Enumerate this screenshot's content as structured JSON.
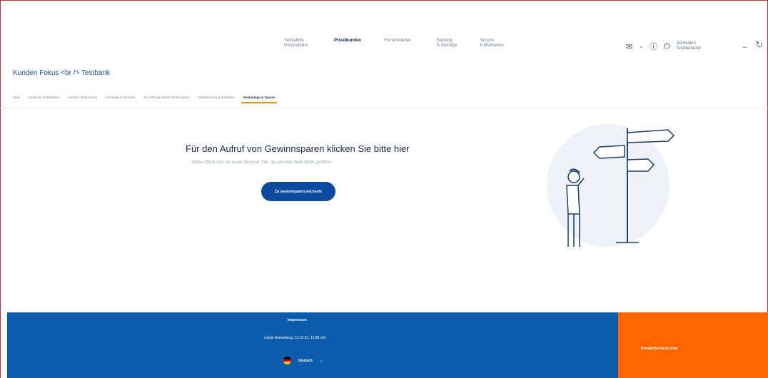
{
  "top_nav": {
    "items": [
      {
        "label": "Selbsthilfe\nGeneralvilus"
      },
      {
        "label": "Privatkunden",
        "active": true
      },
      {
        "label": "Firmenkunden"
      },
      {
        "label": "Banking\n& Verträge"
      },
      {
        "label": "Service\n& Mehrwerte"
      }
    ],
    "logout_label": "Abmelden\nTestbenutzer"
  },
  "bank_title": "Kunden Fokus <br /> Testbank",
  "sub_nav": {
    "items": [
      {
        "label": "Start"
      },
      {
        "label": "Girokonto & Bezahlen"
      },
      {
        "label": "Kredit & Finanzieren"
      },
      {
        "label": "Immobilie & Wohnen"
      },
      {
        "label": "R+V Private Rente Performance"
      },
      {
        "label": "Versicherung & Schützen"
      },
      {
        "label": "Geldanlage & Sparen",
        "active": true
      }
    ]
  },
  "main": {
    "headline": "Für den Aufruf von Gewinnsparen klicken Sie bitte hier",
    "subline": "Dabei öffnet sich ein neuer Browser-Tab, die aktuelle Seite bleibt geöffnet.",
    "cta_label": "Zu Gewinnsparen wechseln"
  },
  "footer": {
    "impressum": "Impressum",
    "last_login": "Letzte Anmeldung: 13.10.21, 11:38 Uhr",
    "language": "Deutsch",
    "service_center": "KundenServiceCenter"
  },
  "colors": {
    "primary_blue": "#0b5cad",
    "button_blue": "#0a4a9f",
    "orange": "#ff6600",
    "accent_orange": "#f39200"
  }
}
